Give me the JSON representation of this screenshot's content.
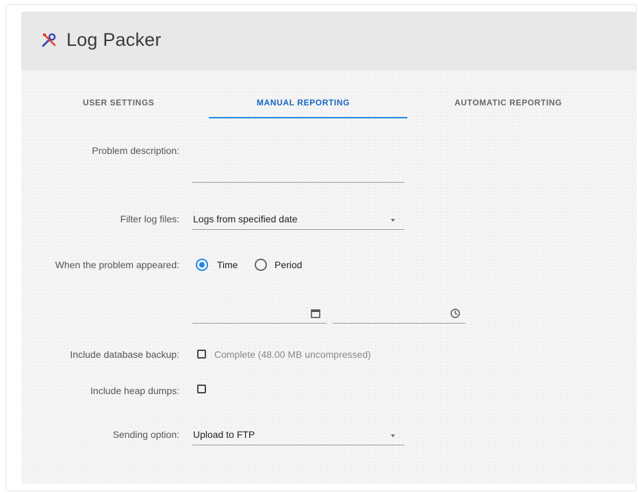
{
  "app": {
    "title": "Log Packer",
    "icon": "tools-icon"
  },
  "tabs": [
    {
      "label": "USER SETTINGS",
      "active": false
    },
    {
      "label": "MANUAL REPORTING",
      "active": true
    },
    {
      "label": "AUTOMATIC REPORTING",
      "active": false
    }
  ],
  "form": {
    "problem_description": {
      "label": "Problem description:",
      "value": ""
    },
    "filter_log_files": {
      "label": "Filter log files:",
      "value": "Logs from specified date"
    },
    "problem_appeared": {
      "label": "When the problem appeared:",
      "options": [
        {
          "label": "Time",
          "checked": true
        },
        {
          "label": "Period",
          "checked": false
        }
      ]
    },
    "date_time": {
      "date_value": "",
      "time_value": "",
      "date_icon": "calendar-icon",
      "time_icon": "clock-icon"
    },
    "database_backup": {
      "label": "Include database backup:",
      "option_label": "Complete (48.00 MB uncompressed)",
      "checked": false
    },
    "heap_dumps": {
      "label": "Include heap dumps:",
      "checked": false
    },
    "sending_option": {
      "label": "Sending option:",
      "value": "Upload to FTP"
    }
  },
  "colors": {
    "accent": "#1e88e5",
    "header_bg": "#e8e8e8",
    "panel_bg": "#f5f5f5"
  }
}
